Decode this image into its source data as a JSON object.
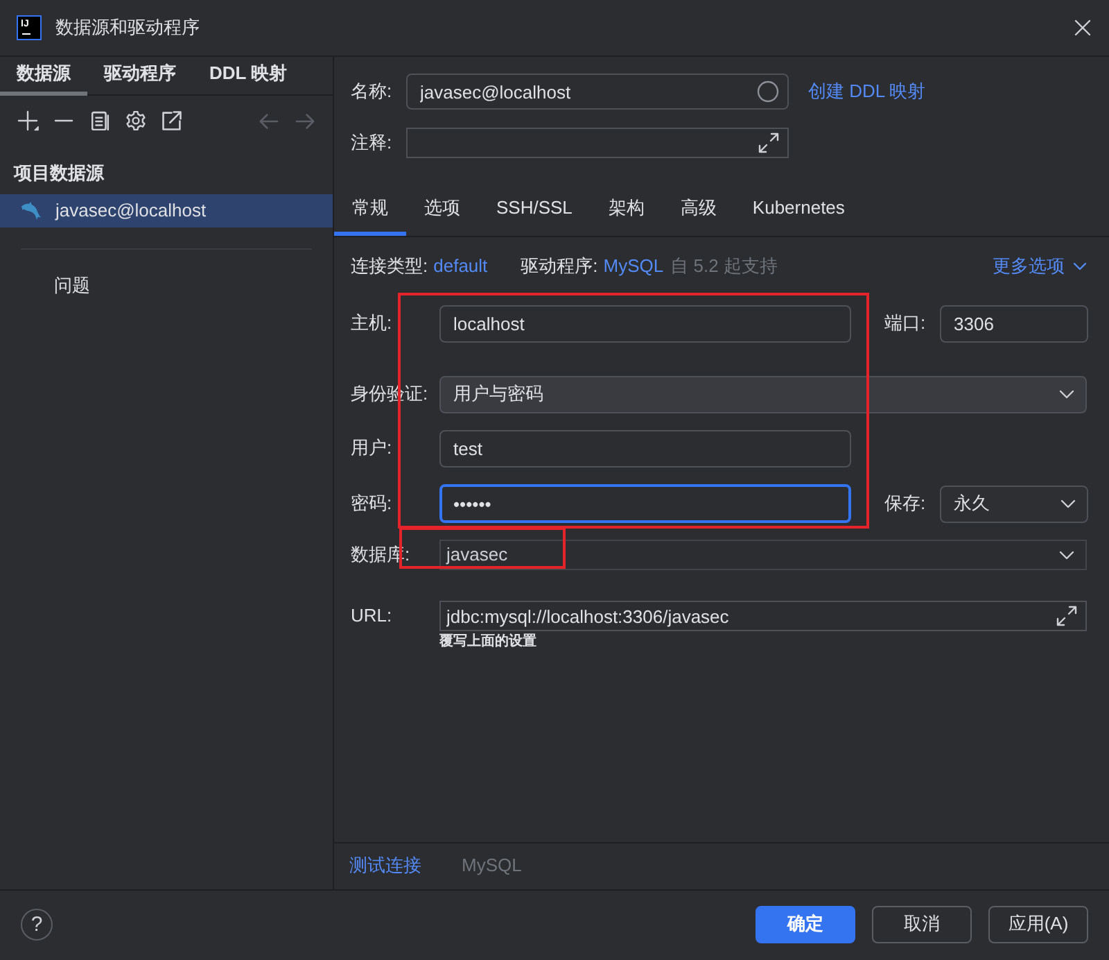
{
  "window": {
    "title": "数据源和驱动程序",
    "logo_text": "IJ"
  },
  "sidebar": {
    "tabs": [
      {
        "label": "数据源",
        "selected": true
      },
      {
        "label": "驱动程序",
        "selected": false
      },
      {
        "label": "DDL 映射",
        "selected": false
      }
    ],
    "toolbar": [
      {
        "kind": "add",
        "disabled": false
      },
      {
        "kind": "remove",
        "disabled": false
      },
      {
        "kind": "duplicate",
        "disabled": false
      },
      {
        "kind": "settings",
        "disabled": false
      },
      {
        "kind": "export",
        "disabled": false
      },
      {
        "kind": "back",
        "disabled": true
      },
      {
        "kind": "forward",
        "disabled": true
      }
    ],
    "section_title": "项目数据源",
    "items": [
      {
        "label": "javasec@localhost",
        "selected": true
      }
    ],
    "problems": "问题"
  },
  "header": {
    "name_field": {
      "label": "名称:",
      "value": "javasec@localhost"
    },
    "ddl_link": "创建 DDL 映射",
    "comment_field": {
      "label": "注释:"
    }
  },
  "tabs": [
    {
      "label": "常规",
      "selected": true
    },
    {
      "label": "选项",
      "selected": false
    },
    {
      "label": "SSH/SSL",
      "selected": false
    },
    {
      "label": "架构",
      "selected": false
    },
    {
      "label": "高级",
      "selected": false
    },
    {
      "label": "Kubernetes",
      "selected": false
    }
  ],
  "connection": {
    "type_label": "连接类型:",
    "type_value": "default",
    "driver_label": "驱动程序:",
    "driver_value": "MySQL",
    "driver_note": "自 5.2 起支持",
    "more_options": "更多选项"
  },
  "fields": [
    {
      "kind": "text",
      "label": "主机:",
      "value": "localhost",
      "focused": false,
      "boxed": true,
      "side": {
        "kind": "text",
        "label": "端口:",
        "value": "3306"
      }
    },
    {
      "kind": "select",
      "label": "身份验证:",
      "value": "用户与密码",
      "focused": false,
      "boxed": true
    },
    {
      "kind": "text",
      "label": "用户:",
      "value": "test",
      "focused": false,
      "boxed": true
    },
    {
      "kind": "text",
      "label": "密码:",
      "value": "••••••",
      "focused": true,
      "boxed": true,
      "side": {
        "kind": "select",
        "label": "保存:",
        "value": "永久"
      }
    },
    {
      "kind": "combo",
      "label": "数据库:",
      "value": "javasec",
      "focused": false,
      "boxed": false
    },
    {
      "kind": "url",
      "label": "URL:",
      "value": "jdbc:mysql://localhost:3306/javasec",
      "focused": false,
      "boxed": false,
      "hint": "覆写上面的设置"
    }
  ],
  "annotations": [
    {
      "kind": "block",
      "color": "#e4232b"
    },
    {
      "kind": "tag",
      "color": "#e4232b"
    }
  ],
  "bottom_bar": {
    "test_link": "测试连接",
    "driver": {
      "label": "MySQL",
      "disabled": true
    }
  },
  "footer": {
    "help": "?",
    "buttons": [
      {
        "label": "确定",
        "kind": "primary"
      },
      {
        "label": "取消",
        "kind": "secondary"
      },
      {
        "label": "应用(A)",
        "kind": "secondary"
      }
    ]
  }
}
